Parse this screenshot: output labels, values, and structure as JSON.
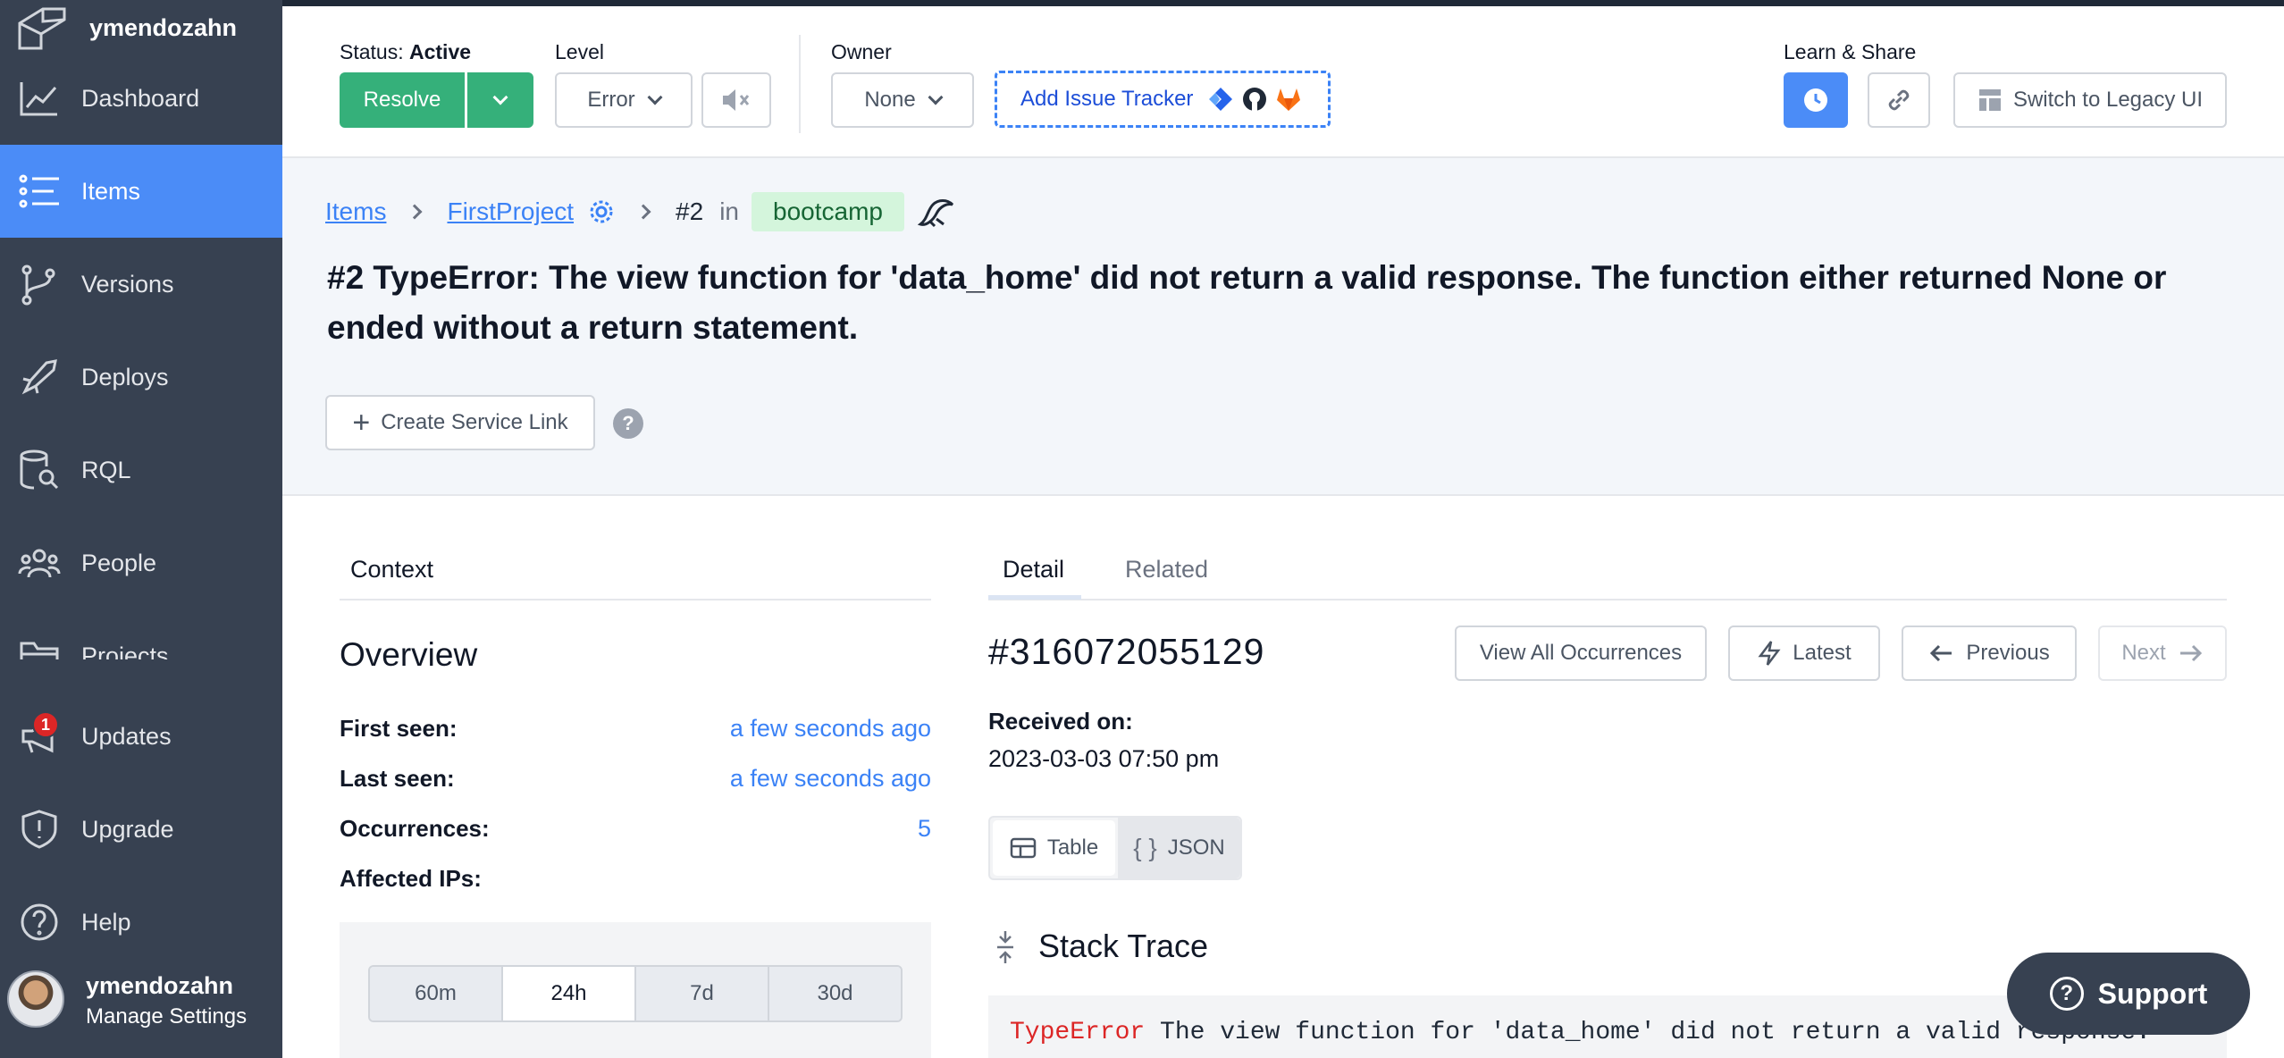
{
  "sidebar": {
    "org_name": "ymendozahn",
    "items": [
      {
        "label": "Dashboard"
      },
      {
        "label": "Items"
      },
      {
        "label": "Versions"
      },
      {
        "label": "Deploys"
      },
      {
        "label": "RQL"
      },
      {
        "label": "People"
      },
      {
        "label": "Projects"
      },
      {
        "label": "Updates",
        "badge": "1"
      },
      {
        "label": "Upgrade"
      },
      {
        "label": "Help"
      }
    ],
    "user": {
      "name": "ymendozahn",
      "manage_label": "Manage Settings"
    }
  },
  "toolbar": {
    "status_prefix": "Status:",
    "status_value": "Active",
    "resolve_label": "Resolve",
    "level_label": "Level",
    "level_value": "Error",
    "owner_label": "Owner",
    "owner_value": "None",
    "tracker_label": "Add Issue Tracker",
    "learn_label": "Learn & Share",
    "legacy_label": "Switch to Legacy UI"
  },
  "breadcrumb": {
    "items_label": "Items",
    "project_label": "FirstProject",
    "item_number": "#2",
    "in_label": "in",
    "environment": "bootcamp"
  },
  "item": {
    "title": "#2 TypeError: The view function for 'data_home' did not return a valid response. The function either returned None or ended without a return statement.",
    "service_link_label": "Create Service Link"
  },
  "context": {
    "tab_label": "Context",
    "overview_title": "Overview",
    "rows": [
      {
        "label": "First seen:",
        "value": "a few seconds ago"
      },
      {
        "label": "Last seen:",
        "value": "a few seconds ago"
      },
      {
        "label": "Occurrences:",
        "value": "5"
      },
      {
        "label": "Affected IPs:",
        "value": ""
      }
    ],
    "ranges": [
      "60m",
      "24h",
      "7d",
      "30d"
    ],
    "selected_range": "24h"
  },
  "detail": {
    "tabs": [
      {
        "label": "Detail"
      },
      {
        "label": "Related"
      }
    ],
    "occurrence_id": "#316072055129",
    "buttons": {
      "view_all": "View All Occurrences",
      "latest": "Latest",
      "previous": "Previous",
      "next": "Next"
    },
    "received_label": "Received on:",
    "received_value": "2023-03-03 07:50 pm",
    "view_modes": [
      "Table",
      "JSON"
    ],
    "stack_title": "Stack Trace",
    "code_error": "TypeError",
    "code_message": "The view function for 'data_home' did not return a valid response."
  },
  "support_label": "Support",
  "colors": {
    "sidebar_bg": "#374151",
    "active_blue": "#4b8cf7",
    "resolve_green": "#35b07a",
    "link_blue": "#3b82f6"
  }
}
